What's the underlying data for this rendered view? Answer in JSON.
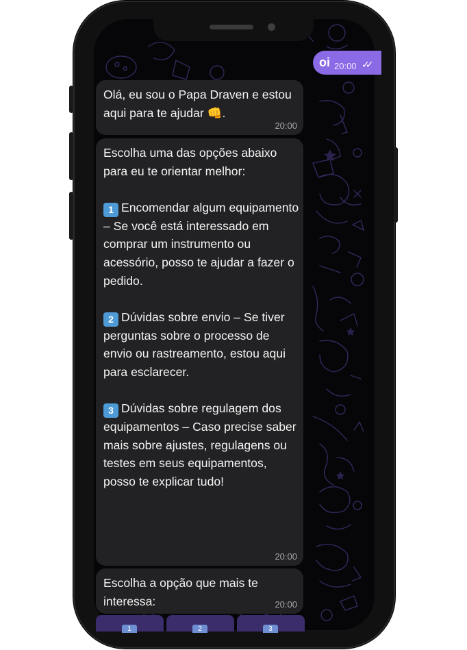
{
  "colors": {
    "outgoing_bubble": "#8b6ae6",
    "incoming_bubble": "#222224",
    "chat_background": "#060608",
    "reply_button": "#3b2d6b"
  },
  "outgoing": {
    "text": "oi",
    "time": "20:00",
    "status_icon": "double-check-icon"
  },
  "messages": [
    {
      "text_before_emoji": "Olá, eu sou o Papa Draven e estou aqui para te ajudar ",
      "emoji": "👊",
      "text_after_emoji": ".",
      "time": "20:00"
    },
    {
      "intro": "Escolha uma das opções abaixo para eu te orientar melhor:",
      "options": [
        {
          "key": "1",
          "text": "Encomendar algum equipamento – Se você está interessado em comprar um instrumento ou acessório, posso te ajudar a fazer o pedido."
        },
        {
          "key": "2",
          "text": "Dúvidas sobre envio – Se tiver perguntas sobre o processo de envio ou rastreamento, estou aqui para esclarecer."
        },
        {
          "key": "3",
          "text": "Dúvidas sobre regulagem dos equipamentos – Caso precise saber mais sobre ajustes, regulagens ou testes em seus equipamentos, posso te explicar tudo!"
        }
      ],
      "time": "20:00"
    },
    {
      "text": "Escolha a opção que mais te interessa:",
      "time": "20:00"
    }
  ],
  "reply_buttons": [
    {
      "key": "1"
    },
    {
      "key": "2"
    },
    {
      "key": "3"
    }
  ]
}
